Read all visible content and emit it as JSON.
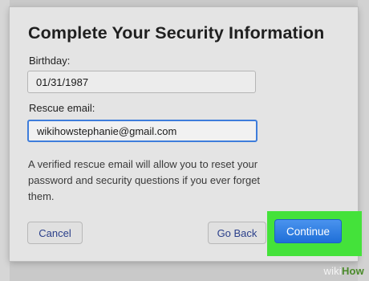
{
  "dialog": {
    "title": "Complete Your Security Information",
    "birthday_label": "Birthday:",
    "birthday_value": "01/31/1987",
    "rescue_label": "Rescue email:",
    "rescue_value": "wikihowstephanie@gmail.com",
    "description": "A verified rescue email will allow you to reset your password and security questions if you ever forget them.",
    "cancel_label": "Cancel",
    "goback_label": "Go Back",
    "continue_label": "Continue"
  },
  "watermark": {
    "wiki": "wiki",
    "how": "How"
  },
  "colors": {
    "accent": "#1f6fd8",
    "highlight": "#44e23a",
    "button_text": "#2a3f8a"
  }
}
